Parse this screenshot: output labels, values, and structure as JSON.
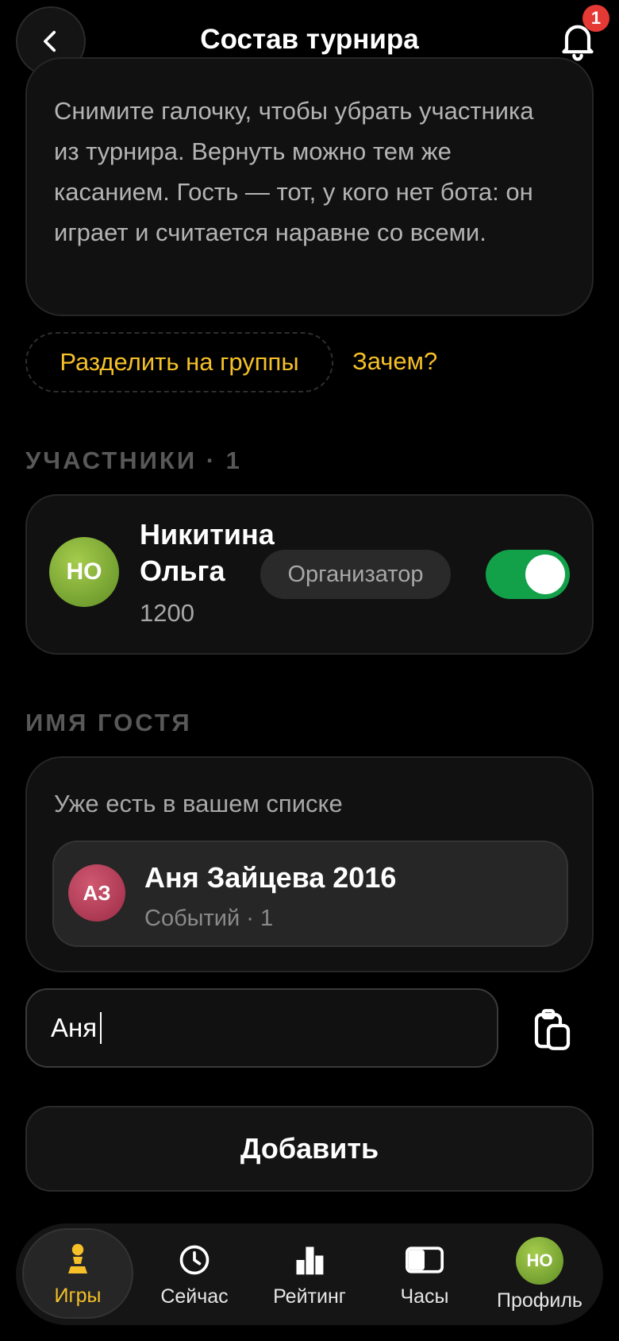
{
  "header": {
    "title": "Состав турнира",
    "notification_count": "1"
  },
  "info": {
    "text": "Снимите галочку, чтобы убрать участника из турнира. Вернуть можно тем же касанием. Гость — тот, у кого нет бота: он играет и считается наравне со всеми."
  },
  "groups": {
    "split_label": "Разделить на группы",
    "why_label": "Зачем?"
  },
  "participants": {
    "section_label": "УЧАСТНИКИ · 1",
    "items": [
      {
        "initials": "НО",
        "name": "Никитина Ольга",
        "rating": "1200",
        "role": "Организатор",
        "included": true
      }
    ]
  },
  "guest": {
    "section_label": "ИМЯ ГОСТЯ",
    "hint": "Уже есть в вашем списке",
    "suggestions": [
      {
        "initials": "АЗ",
        "name": "Аня Зайцева 2016",
        "meta": "Событий · 1"
      }
    ],
    "input_value": "Аня",
    "add_label": "Добавить"
  },
  "nav": {
    "items": [
      {
        "label": "Игры",
        "icon": "pawn-icon",
        "active": true
      },
      {
        "label": "Сейчас",
        "icon": "clock-icon",
        "active": false
      },
      {
        "label": "Рейтинг",
        "icon": "bar-chart-icon",
        "active": false
      },
      {
        "label": "Часы",
        "icon": "chess-clock-icon",
        "active": false
      },
      {
        "label": "Профиль",
        "icon": "avatar",
        "initials": "НО",
        "active": false
      }
    ]
  },
  "colors": {
    "accent": "#f5c028",
    "toggle_on": "#12a149",
    "badge": "#e53935"
  }
}
